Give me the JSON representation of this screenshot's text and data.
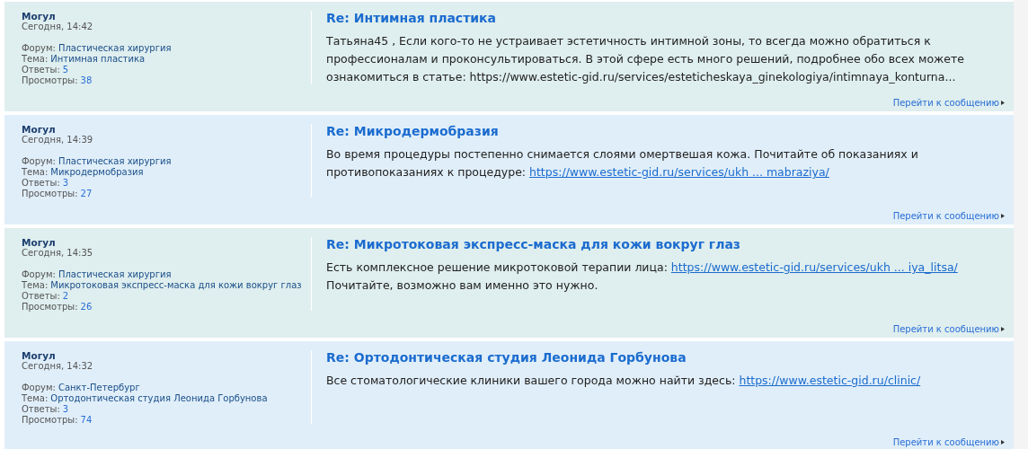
{
  "posts": [
    {
      "author": "Могул",
      "time": "Сегодня, 14:42",
      "forum_label": "Форум:",
      "forum": "Пластическая хирургия",
      "topic_label": "Тема:",
      "topic": "Интимная пластика",
      "replies_label": "Ответы:",
      "replies": "5",
      "views_label": "Просмотры:",
      "views": "38",
      "title": "Re: Интимная пластика",
      "lines": [
        [
          {
            "kind": "text",
            "text": "Татьяна45 , Если кого-то не устраивает эстетичность интимной зоны, то всегда можно обратиться к профессионалам и проконсультироваться. В этой сфере есть много решений, подробнее обо всех можете ознакомиться в статье: https://www.estetic-gid.ru/services/esteticheskaya_ginekologiya/intimnaya_konturna..."
          }
        ]
      ],
      "goto": "Перейти к сообщению"
    },
    {
      "author": "Могул",
      "time": "Сегодня, 14:39",
      "forum_label": "Форум:",
      "forum": "Пластическая хирургия",
      "topic_label": "Тема:",
      "topic": "Микродермобразия",
      "replies_label": "Ответы:",
      "replies": "3",
      "views_label": "Просмотры:",
      "views": "27",
      "title": "Re: Микродермобразия",
      "lines": [
        [
          {
            "kind": "text",
            "text": "Во время процедуры постепенно снимается слоями омертвешая кожа. Почитайте об показаниях и противопоказаниях к процедуре: "
          },
          {
            "kind": "link",
            "text": "https://www.estetic-gid.ru/services/ukh ... mabraziya/"
          }
        ]
      ],
      "goto": "Перейти к сообщению"
    },
    {
      "author": "Могул",
      "time": "Сегодня, 14:35",
      "forum_label": "Форум:",
      "forum": "Пластическая хирургия",
      "topic_label": "Тема:",
      "topic": "Микротоковая экспресс-маска для кожи вокруг глаз",
      "replies_label": "Ответы:",
      "replies": "2",
      "views_label": "Просмотры:",
      "views": "26",
      "title": "Re: Микротоковая экспресс-маска для кожи вокруг глаз",
      "lines": [
        [
          {
            "kind": "text",
            "text": "Есть комплексное решение микротоковой терапии лица: "
          },
          {
            "kind": "link",
            "text": "https://www.estetic-gid.ru/services/ukh ... iya_litsa/"
          }
        ],
        [
          {
            "kind": "text",
            "text": "Почитайте, возможно вам именно это нужно."
          }
        ]
      ],
      "goto": "Перейти к сообщению"
    },
    {
      "author": "Могул",
      "time": "Сегодня, 14:32",
      "forum_label": "Форум:",
      "forum": "Санкт-Петербург",
      "topic_label": "Тема:",
      "topic": "Ортодонтическая студия Леонида Горбунова",
      "replies_label": "Ответы:",
      "replies": "3",
      "views_label": "Просмотры:",
      "views": "74",
      "title": "Re: Ортодонтическая студия Леонида Горбунова",
      "lines": [
        [
          {
            "kind": "text",
            "text": "Все стоматологические клиники вашего города можно найти здесь: "
          },
          {
            "kind": "link",
            "text": "https://www.estetic-gid.ru/clinic/"
          }
        ]
      ],
      "goto": "Перейти к сообщению"
    }
  ]
}
